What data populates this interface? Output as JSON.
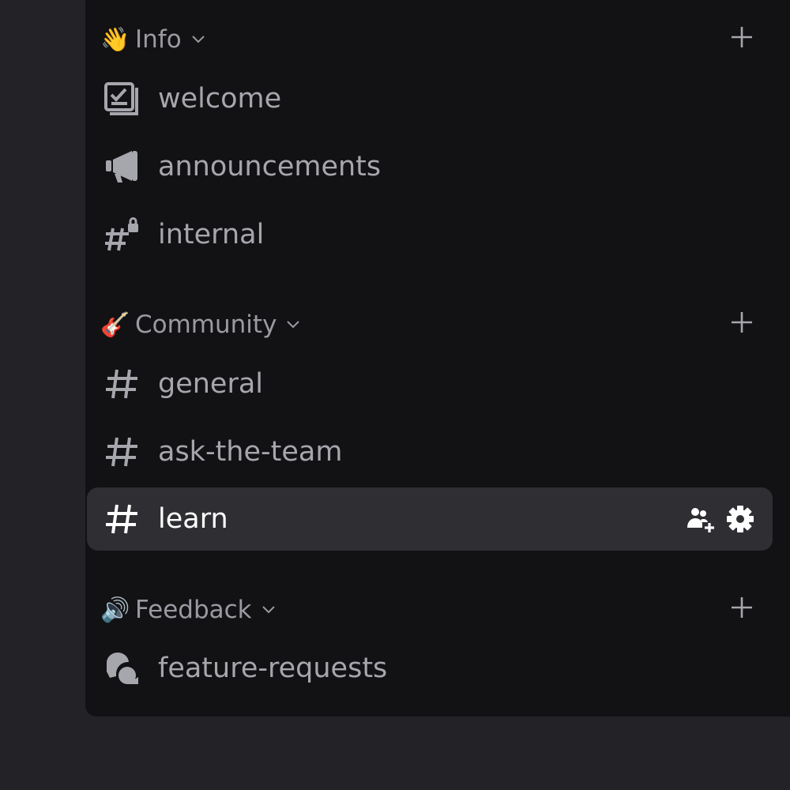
{
  "categories": [
    {
      "name": "Info",
      "emoji": "👋",
      "channels": [
        {
          "label": "welcome",
          "icon": "rules-icon"
        },
        {
          "label": "announcements",
          "icon": "megaphone-icon"
        },
        {
          "label": "internal",
          "icon": "locked-hash-icon"
        }
      ]
    },
    {
      "name": "Community",
      "emoji": "🎸",
      "channels": [
        {
          "label": "general",
          "icon": "hash-icon"
        },
        {
          "label": "ask-the-team",
          "icon": "hash-icon"
        },
        {
          "label": "learn",
          "icon": "hash-icon",
          "active": true
        }
      ]
    },
    {
      "name": "Feedback",
      "emoji": "🔊",
      "channels": [
        {
          "label": "feature-requests",
          "icon": "forum-icon"
        }
      ]
    }
  ],
  "colors": {
    "background": "#232327",
    "panel": "#121214",
    "active_row": "#2e2e33",
    "text_muted": "#a6a6ad",
    "text_active": "#ffffff"
  }
}
